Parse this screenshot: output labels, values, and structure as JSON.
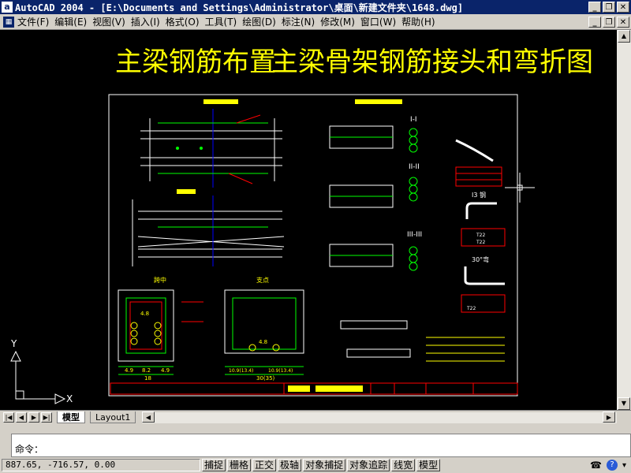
{
  "window": {
    "title": "AutoCAD 2004 - [E:\\Documents and Settings\\Administrator\\桌面\\新建文件夹\\1648.dwg]",
    "app_icon": "autocad-logo-icon",
    "minimize": "_",
    "restore": "❐",
    "close": "✕"
  },
  "menu": {
    "items": [
      "文件(F)",
      "编辑(E)",
      "视图(V)",
      "插入(I)",
      "格式(O)",
      "工具(T)",
      "绘图(D)",
      "标注(N)",
      "修改(M)",
      "窗口(W)",
      "帮助(H)"
    ]
  },
  "drawing": {
    "main_title": "主梁钢筋布置",
    "main_title_2": "主梁骨架钢筋接头和弯折图",
    "section_labels": [
      "I-I",
      "II-II",
      "III-III",
      "I3 钢",
      "30°弯"
    ],
    "dims": [
      "4.8",
      "4.9",
      "8.2",
      "4.9",
      "18",
      "10.9(13.4)",
      "10.9(13.4)",
      "30(35)",
      "4.8",
      "4.8"
    ],
    "side_labels": [
      "跨中",
      "支点"
    ],
    "table_rows": [
      "T22",
      "T22",
      "T22"
    ],
    "ucs_x": "X",
    "ucs_y": "Y",
    "colors": {
      "yellow": "#ffff00",
      "white": "#ffffff",
      "red": "#ff0000",
      "green": "#00ff00",
      "cyan": "#00ffff",
      "blue": "#0000ff",
      "magenta": "#ff00ff"
    }
  },
  "layout_tabs": {
    "nav": [
      "|◀",
      "◀",
      "▶",
      "▶|"
    ],
    "tabs": [
      "模型",
      "Layout1"
    ]
  },
  "command": {
    "prompt": "命令："
  },
  "status": {
    "coords": "887.65, -716.57, 0.00",
    "buttons": [
      "捕捉",
      "栅格",
      "正交",
      "极轴",
      "对象捕捉",
      "对象追踪",
      "线宽",
      "模型"
    ]
  }
}
